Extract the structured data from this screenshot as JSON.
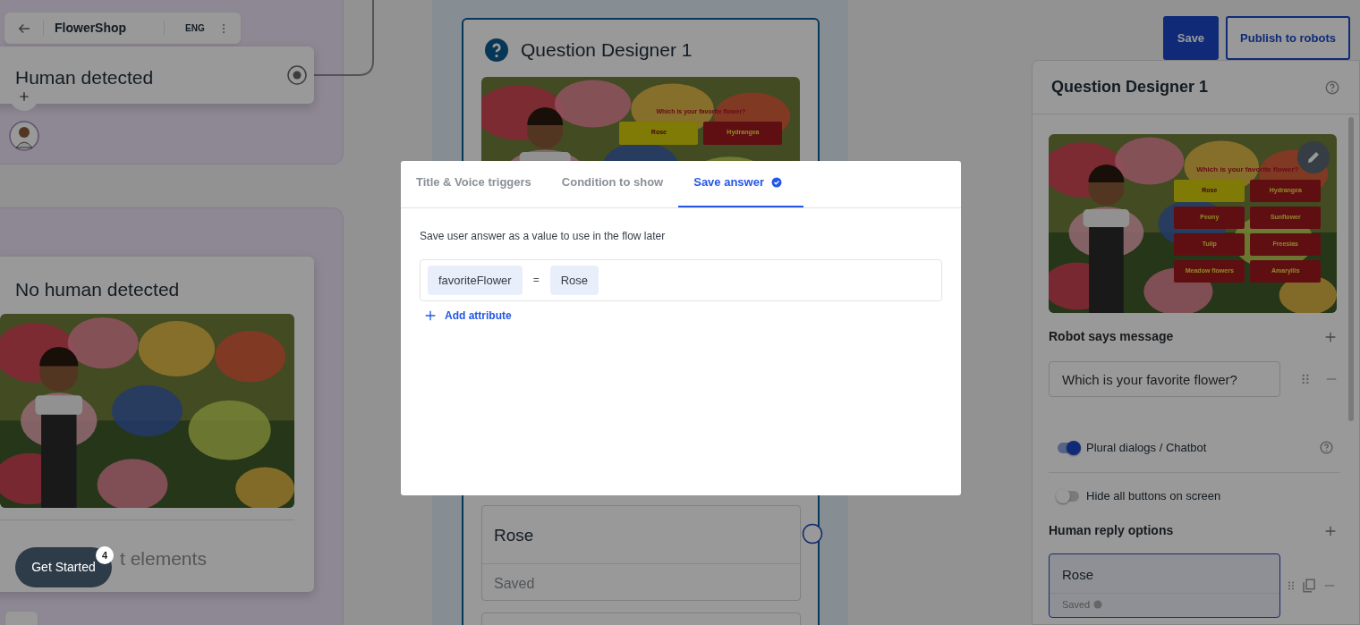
{
  "toolbar": {
    "project": "FlowerShop",
    "language": "ENG"
  },
  "trigger_node": {
    "title": "Human detected"
  },
  "no_human_node": {
    "title": "No human detected",
    "footer": "t elements"
  },
  "question_node": {
    "title": "Question Designer 1",
    "preview": {
      "question": "Which is your favorite flower?",
      "options": [
        {
          "label": "Rose",
          "selected": true
        },
        {
          "label": "Hydrangea",
          "selected": false
        }
      ]
    },
    "replies": [
      {
        "label": "Rose",
        "status": "Saved"
      }
    ]
  },
  "actions": [
    {
      "label": "Save",
      "kind": "primary"
    },
    {
      "label": "Publish to robots",
      "kind": "outline"
    }
  ],
  "panel": {
    "title": "Question Designer 1",
    "preview": {
      "question": "Which is your favorite flower?",
      "options": [
        {
          "label": "Rose",
          "selected": true
        },
        {
          "label": "Hydrangea",
          "selected": false
        },
        {
          "label": "Peony",
          "selected": false
        },
        {
          "label": "Sunflower",
          "selected": false
        },
        {
          "label": "Tulip",
          "selected": false
        },
        {
          "label": "Freesias",
          "selected": false
        },
        {
          "label": "Meadow flowers",
          "selected": false
        },
        {
          "label": "Amaryllis",
          "selected": false
        }
      ]
    },
    "robot_says": {
      "heading": "Robot says message",
      "messages": [
        {
          "text": "Which is your favorite flower?"
        }
      ]
    },
    "toggles": [
      {
        "label": "Plural dialogs / Chatbot",
        "on": true,
        "help": true
      },
      {
        "label": "Hide all buttons on screen",
        "on": false,
        "help": false
      }
    ],
    "replies": {
      "heading": "Human reply options",
      "options": [
        {
          "label": "Rose",
          "status": "Saved"
        }
      ]
    }
  },
  "modal": {
    "tabs": [
      {
        "label": "Title & Voice triggers",
        "selected": false,
        "done": false
      },
      {
        "label": "Condition to show",
        "selected": false,
        "done": false
      },
      {
        "label": "Save answer",
        "selected": true,
        "done": true
      }
    ],
    "description": "Save user answer as a value to use in the flow later",
    "assignment": {
      "attribute": "favoriteFlower",
      "operator": "=",
      "value": "Rose"
    },
    "add_label": "Add attribute"
  },
  "get_started": {
    "label": "Get Started",
    "count": "4"
  }
}
